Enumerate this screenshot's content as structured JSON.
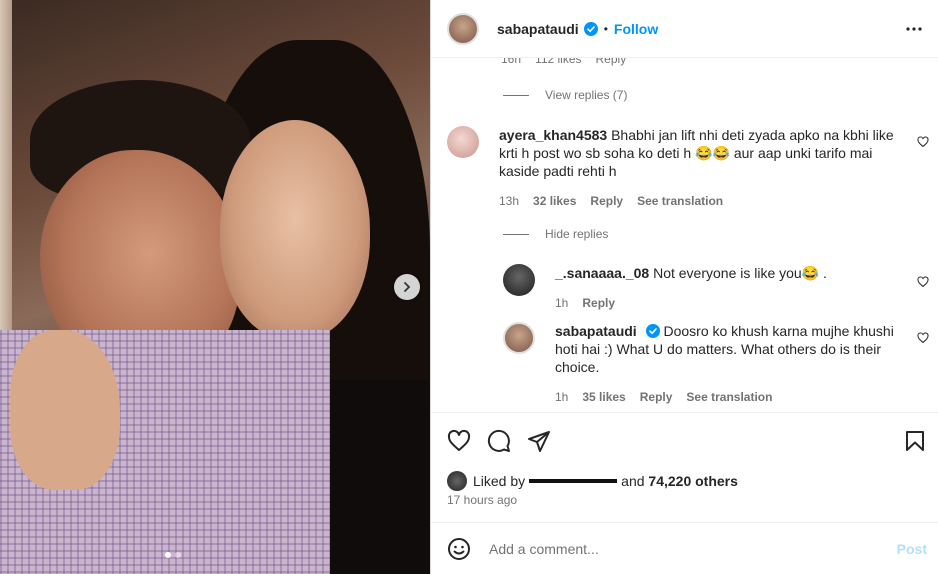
{
  "post": {
    "username": "sabapataudi",
    "follow_label": "Follow",
    "dot": "•"
  },
  "comments": {
    "cut_time": "16h",
    "cut_likes": "112 likes",
    "cut_reply": "Reply",
    "view_replies": "View replies (7)",
    "hide_replies": "Hide replies",
    "items": [
      {
        "username": "ayera_khan4583",
        "text": "Bhabhi jan lift nhi deti zyada apko na kbhi like krti h post wo sb soha ko deti h 😂😂 aur aap unki tarifo mai kaside padti rehti h",
        "time": "13h",
        "likes": "32 likes",
        "reply": "Reply",
        "translation": "See translation"
      },
      {
        "username": "_.sanaaaa._08",
        "text": "Not everyone is like you😂 .",
        "time": "1h",
        "reply": "Reply"
      },
      {
        "username": "sabapataudi",
        "text": "Doosro ko khush karna mujhe khushi hoti hai :) What U do matters. What others do is their choice.",
        "time": "1h",
        "likes": "35 likes",
        "reply": "Reply",
        "translation": "See translation"
      }
    ]
  },
  "likes": {
    "prefix": "Liked by",
    "and": "and",
    "count": "74,220 others",
    "time_ago": "17 hours ago"
  },
  "composer": {
    "placeholder": "Add a comment...",
    "post_label": "Post"
  },
  "colors": {
    "accent": "#0095f6",
    "muted": "#737373",
    "post_disabled": "#b2dffc"
  },
  "icons": [
    "more-icon",
    "verified-icon",
    "heart-icon",
    "comment-icon",
    "share-icon",
    "bookmark-icon",
    "emoji-icon",
    "chevron-right-icon"
  ]
}
